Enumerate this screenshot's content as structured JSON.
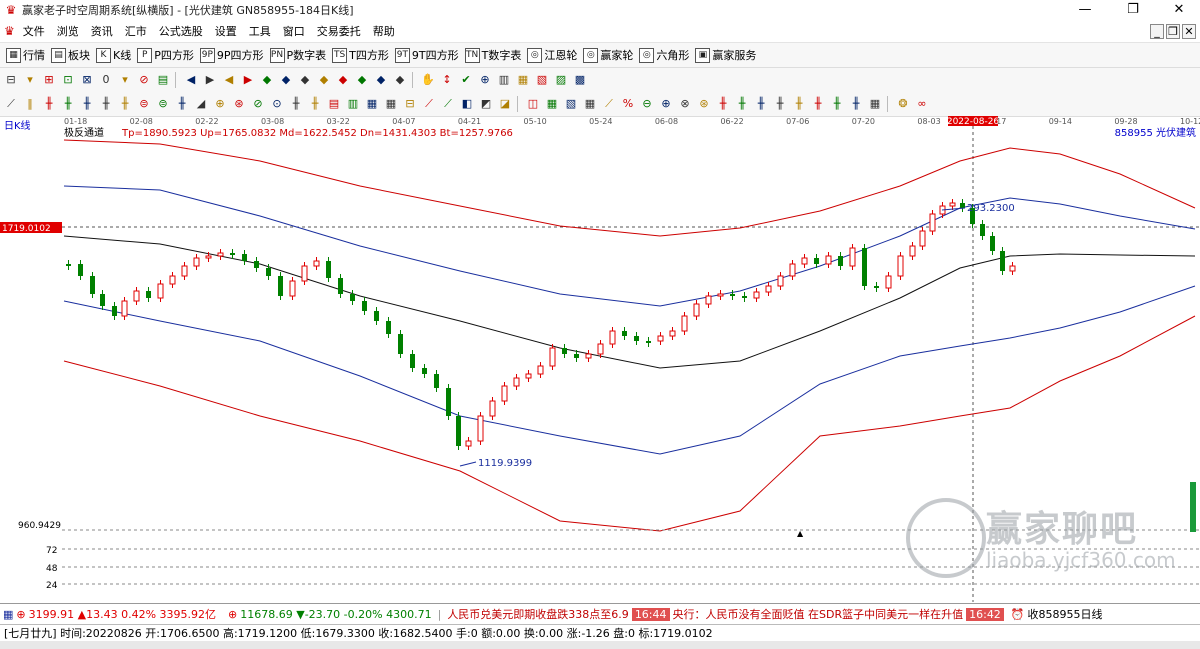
{
  "window": {
    "title": "赢家老子时空周期系统[纵横版] - [光伏建筑  GN858955-184日K线]",
    "min_symbol": "—",
    "max_symbol": "❐",
    "close_symbol": "✕"
  },
  "menu": [
    "文件",
    "浏览",
    "资讯",
    "汇市",
    "公式选股",
    "设置",
    "工具",
    "窗口",
    "交易委托",
    "帮助"
  ],
  "toolbar1": [
    {
      "icon": "grid-icon",
      "label": "行情"
    },
    {
      "icon": "blocks-icon",
      "label": "板块"
    },
    {
      "icon": "kline-icon",
      "label": "K线"
    },
    {
      "icon": "p-square-icon",
      "label": "P四方形"
    },
    {
      "icon": "p9-square-icon",
      "label": "9P四方形"
    },
    {
      "icon": "p-table-icon",
      "label": "P数字表"
    },
    {
      "icon": "t-square-icon",
      "label": "T四方形"
    },
    {
      "icon": "t9-square-icon",
      "label": "9T四方形"
    },
    {
      "icon": "t-table-icon",
      "label": "T数字表"
    },
    {
      "icon": "wheel-icon",
      "label": "江恩轮"
    },
    {
      "icon": "winner-wheel-icon",
      "label": "赢家轮"
    },
    {
      "icon": "hexagon-icon",
      "label": "六角形"
    },
    {
      "icon": "service-icon",
      "label": "赢家服务"
    }
  ],
  "toolbar1_glyphs": [
    "▦",
    "▤",
    "K",
    "P",
    "9P",
    "PN",
    "TS",
    "9T",
    "TN",
    "◎",
    "◎",
    "◎",
    "▣"
  ],
  "toolbar2": [
    "⊟",
    "▾",
    "⊞",
    "⊡",
    "⊠",
    "0",
    "▾",
    "⊘",
    "▤",
    "◀",
    "▶",
    "◀",
    "▶",
    "◆",
    "◆",
    "◆",
    "◆",
    "◆",
    "◆",
    "◆",
    "◆",
    "✋",
    "↕",
    "✔",
    "⊕",
    "▥",
    "▦",
    "▧",
    "▨",
    "▩"
  ],
  "toolbar3": [
    "⟋",
    "‖",
    "╫",
    "╫",
    "╫",
    "╫",
    "╫",
    "⊜",
    "⊜",
    "╫",
    "◢",
    "⊕",
    "⊛",
    "⊘",
    "⊙",
    "╫",
    "╫",
    "▤",
    "▥",
    "▦",
    "▦",
    "⊟",
    "⟋",
    "⟋",
    "◧",
    "◩",
    "◪",
    "◫",
    "▦",
    "▧",
    "▦",
    "⟋",
    "%",
    "⊖",
    "⊕",
    "⊗",
    "⊛",
    "╫",
    "╫",
    "╫",
    "╫",
    "╫",
    "╫",
    "╫",
    "╫",
    "▦",
    "❂",
    "∞"
  ],
  "chart": {
    "period_label": "日K线",
    "indicator_name": "极反通道",
    "indicator_values": "Tp=1890.5923  Up=1765.0832  Md=1622.5452  Dn=1431.4303  Bt=1257.9766",
    "code_name": "858955  光伏建筑",
    "dates": [
      "01-18",
      "02-08",
      "02-22",
      "03-08",
      "03-22",
      "04-07",
      "04-21",
      "05-10",
      "05-24",
      "06-08",
      "06-22",
      "07-06",
      "07-20",
      "08-03",
      "08-17",
      "09-14",
      "09-28",
      "10-12"
    ],
    "cursor_date": "2022-08-26",
    "cursor_price": "1719.0102",
    "price_bottom_label": "960.9429",
    "high_label": "293.2300",
    "low_label": "1119.9399",
    "volume_ticks": [
      "72",
      "48",
      "24"
    ],
    "colors": {
      "up": "#e00000",
      "down": "#008000",
      "outer_band": "#cc0000",
      "inner_band": "#1a2f9e",
      "mid_band": "#111111"
    }
  },
  "chart_data": {
    "type": "candlestick",
    "series": [
      {
        "name": "K线",
        "ohlc_note": "daily candles from 2022-01 to 2022-08-26"
      },
      {
        "name": "Tp",
        "value": 1890.5923
      },
      {
        "name": "Up",
        "value": 1765.0832
      },
      {
        "name": "Md",
        "value": 1622.5452
      },
      {
        "name": "Dn",
        "value": 1431.4303
      },
      {
        "name": "Bt",
        "value": 1257.9766
      }
    ],
    "ylim": [
      960.9429,
      1890.5923
    ]
  },
  "status": {
    "sh_index": "3199.91",
    "sh_change": "▲13.43",
    "sh_pct": "0.42%",
    "sh_amount": "3395.92亿",
    "sz_index": "11678.69",
    "sz_change": "▼-23.70",
    "sz_pct": "-0.20%",
    "sz_amount": "4300.71",
    "news1": "人民币兑美元即期收盘跌338点至6.9",
    "time1": "16:44",
    "news2": "央行：人民币没有全面贬值 在SDR篮子中同美元一样在升值",
    "time2": "16:42",
    "watch": "收858955日线"
  },
  "info": {
    "text": "[七月廿九] 时间:20220826 开:1706.6500 高:1719.1200 低:1679.3300 收:1682.5400 手:0 额:0.00 换:0.00 涨:-1.26 盘:0 标:1719.0102"
  },
  "watermark": {
    "brand": "赢家聊吧",
    "url": "liaoba.yjcf360.com"
  }
}
